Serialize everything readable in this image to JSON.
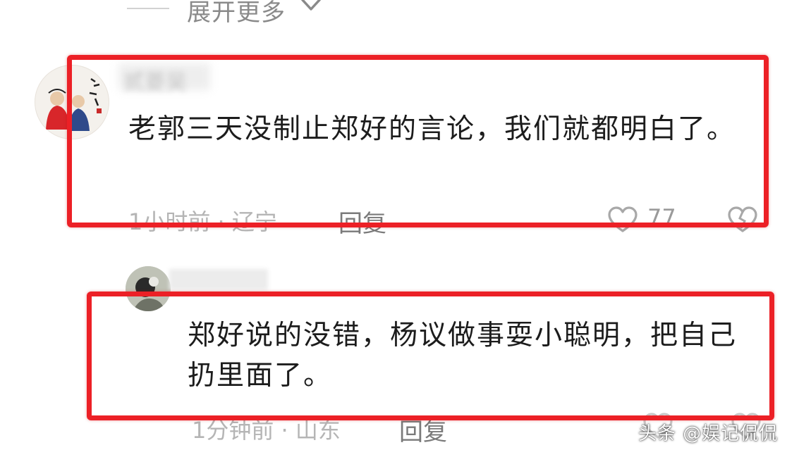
{
  "expand": {
    "label": "展开更多"
  },
  "comments": [
    {
      "username": "贰菱吴",
      "text": "老郭三天没制止郑好的言论，我们就都明白了。",
      "meta": "1小时前 · 辽宁",
      "reply_label": "回复",
      "likes": "77"
    },
    {
      "username": "",
      "text": "郑好说的没错，杨议做事耍小聪明，把自己扔里面了。",
      "meta": "1分钟前 · 山东",
      "reply_label": "回复"
    }
  ],
  "watermark": "头条 @娱记侃侃",
  "colors": {
    "highlight": "#ec2026",
    "meta": "#b5b5b5",
    "text": "#1c1c1c"
  }
}
